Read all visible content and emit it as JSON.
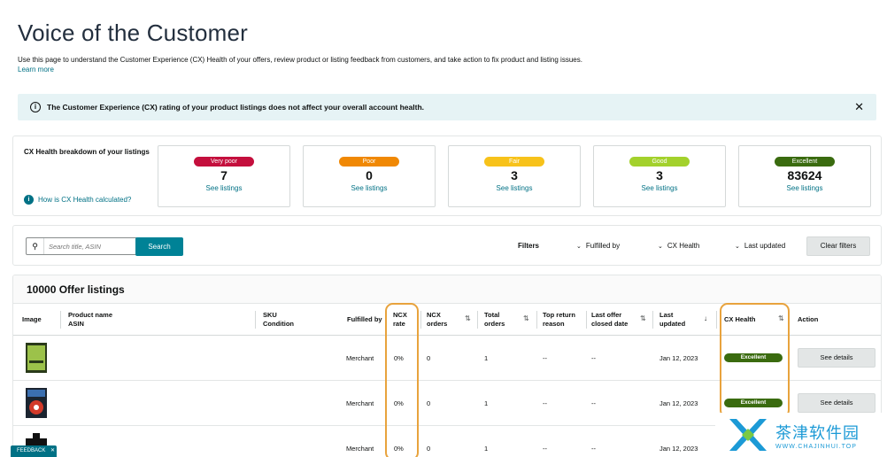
{
  "page": {
    "title": "Voice of the Customer",
    "description": "Use this page to understand the Customer Experience (CX) Health of your offers, review product or listing feedback from customers, and take action to fix product and listing issues.",
    "learn_more": "Learn more"
  },
  "alert": {
    "text": "The Customer Experience (CX) rating of your product listings does not affect your overall account health.",
    "close_icon": "close-icon"
  },
  "breakdown": {
    "title": "CX Health breakdown of your listings",
    "help_link": "How is CX Health calculated?",
    "cards": [
      {
        "label": "Very poor",
        "count": "7",
        "link": "See listings",
        "color": "#c40f3d"
      },
      {
        "label": "Poor",
        "count": "0",
        "link": "See listings",
        "color": "#f08804"
      },
      {
        "label": "Fair",
        "count": "3",
        "link": "See listings",
        "color": "#f7c21a"
      },
      {
        "label": "Good",
        "count": "3",
        "link": "See listings",
        "color": "#a3d12c"
      },
      {
        "label": "Excellent",
        "count": "83624",
        "link": "See listings",
        "color": "#3a6b0f"
      }
    ]
  },
  "filters": {
    "search_placeholder": "Search title, ASIN",
    "search_button": "Search",
    "filters_label": "Filters",
    "fulfilled_by": "Fulfilled by",
    "cx_health": "CX Health",
    "last_updated": "Last updated",
    "clear_filters": "Clear filters"
  },
  "listings": {
    "title": "10000 Offer listings",
    "headers": {
      "image": "Image",
      "product_name": "Product name",
      "asin": "ASIN",
      "sku": "SKU",
      "condition": "Condition",
      "fulfilled_by": "Fulfilled by",
      "ncx_rate_1": "NCX",
      "ncx_rate_2": "rate",
      "ncx_orders_1": "NCX",
      "ncx_orders_2": "orders",
      "total_orders_1": "Total",
      "total_orders_2": "orders",
      "top_return_1": "Top return",
      "top_return_2": "reason",
      "last_offer_1": "Last offer",
      "last_offer_2": "closed date",
      "last_updated_1": "Last",
      "last_updated_2": "updated",
      "cx_health": "CX Health",
      "action": "Action"
    },
    "rows": [
      {
        "fulfilled_by": "Merchant",
        "ncx_rate": "0%",
        "ncx_orders": "0",
        "total_orders": "1",
        "top_return": "--",
        "last_offer": "--",
        "last_updated": "Jan 12, 2023",
        "cx_health": "Excellent",
        "action": "See details"
      },
      {
        "fulfilled_by": "Merchant",
        "ncx_rate": "0%",
        "ncx_orders": "0",
        "total_orders": "1",
        "top_return": "--",
        "last_offer": "--",
        "last_updated": "Jan 12, 2023",
        "cx_health": "Excellent",
        "action": "See details"
      },
      {
        "fulfilled_by": "Merchant",
        "ncx_rate": "0%",
        "ncx_orders": "0",
        "total_orders": "1",
        "top_return": "--",
        "last_offer": "--",
        "last_updated": "Jan 12, 2023",
        "cx_health": "",
        "action": ""
      }
    ]
  },
  "feedback": {
    "label": "FEEDBACK",
    "close": "✕"
  },
  "watermark": {
    "cn": "茶津软件园",
    "en": "WWW.CHAJINHUI.TOP"
  }
}
